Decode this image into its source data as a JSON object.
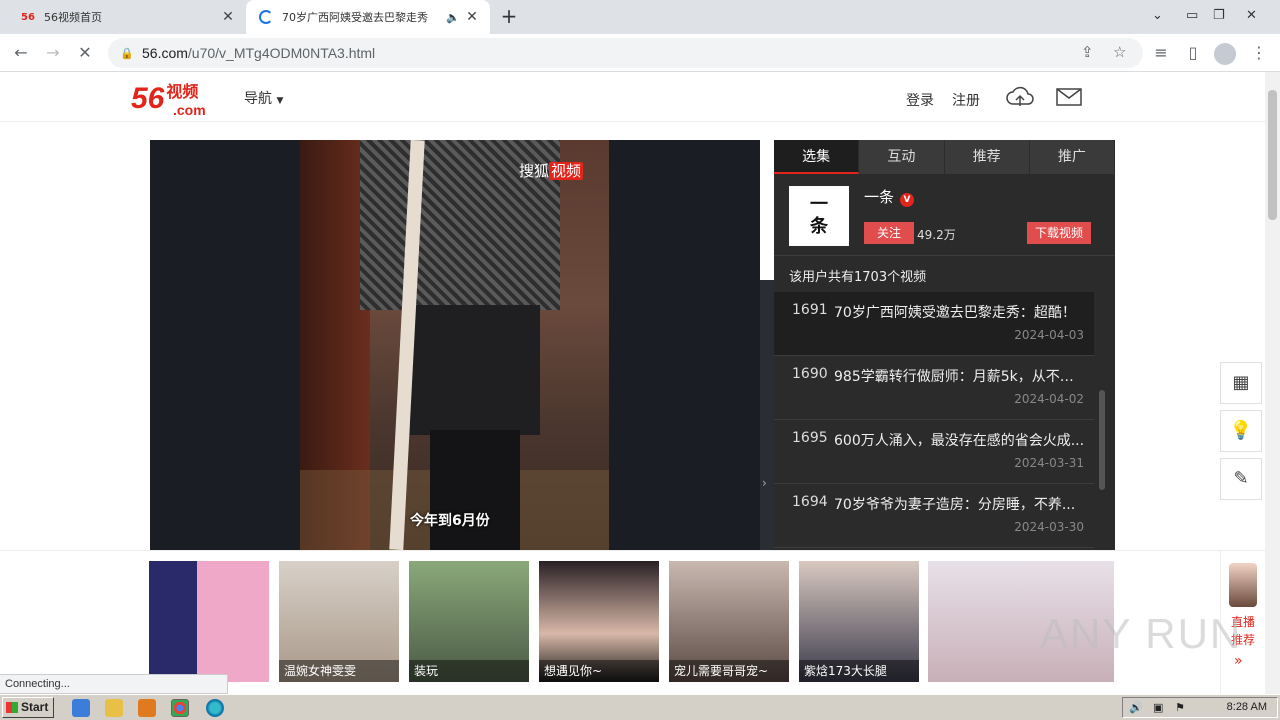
{
  "browser": {
    "tabs": [
      {
        "title": "56视频首页",
        "favicon": "56"
      },
      {
        "title": "70岁广西阿姨受邀去巴黎走秀",
        "favicon": "loading-spinner"
      }
    ],
    "url_host": "56.com",
    "url_path": "/u70/v_MTg4ODM0NTA3.html"
  },
  "site": {
    "logo_num": "56",
    "logo_cn": "视频",
    "logo_com": ".com",
    "nav_label": "导航",
    "login": "登录",
    "register": "注册"
  },
  "player": {
    "watermark_a": "搜狐",
    "watermark_b": "视频",
    "subtitle": "今年到6月份"
  },
  "panel": {
    "tabs": [
      "选集",
      "互动",
      "推荐",
      "推广"
    ],
    "uploader_avatar": "一条",
    "uploader_name": "一条",
    "verified": "V",
    "follow_label": "关注",
    "fans": "49.2万",
    "download_label": "下载视频",
    "count_text": "该用户共有1703个视频",
    "items": [
      {
        "num": "1691",
        "title": "70岁广西阿姨受邀去巴黎走秀：超酷！",
        "date": "2024-04-03"
      },
      {
        "num": "1690",
        "title": "985学霸转行做厨师：月薪5k，从不后悔",
        "date": "2024-04-02"
      },
      {
        "num": "1695",
        "title": "600万人涌入，最没存在感的省会火成...",
        "date": "2024-03-31"
      },
      {
        "num": "1694",
        "title": "70岁爷爷为妻子造房：分房睡，不养...",
        "date": "2024-03-30"
      }
    ]
  },
  "thumbs": [
    {
      "caption": ""
    },
    {
      "caption": "温婉女神雯雯"
    },
    {
      "caption": "装玩"
    },
    {
      "caption": "想遇见你~"
    },
    {
      "caption": "宠儿需要哥哥宠~"
    },
    {
      "caption": "紫焓173大长腿"
    },
    {
      "caption": ""
    }
  ],
  "live": {
    "line1": "直播",
    "line2": "推荐",
    "arrow": "»"
  },
  "status_text": "Connecting...",
  "watermark": "ANY RUN",
  "taskbar": {
    "start": "Start",
    "clock": "8:28 AM"
  },
  "colors": {
    "brand": "#e1251b",
    "button": "#e14d4d",
    "panel_bg": "#2b2b2b"
  }
}
